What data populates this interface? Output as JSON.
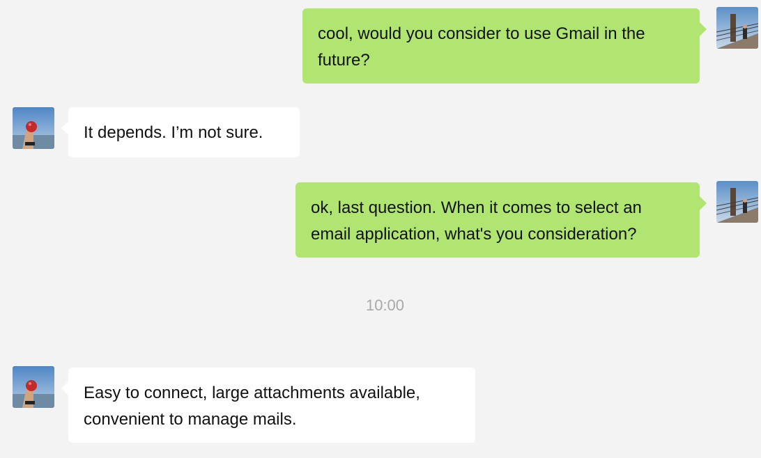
{
  "conversation": {
    "messages": [
      {
        "sender": "me",
        "text": "cool, would you consider to use Gmail in the future?"
      },
      {
        "sender": "contact",
        "text": "It depends. I’m not sure."
      },
      {
        "sender": "me",
        "text": "ok, last question. When it comes to select an email application, what's you consideration?"
      },
      {
        "sender": "contact",
        "text": "Easy to connect, large attachments available, convenient to manage mails."
      }
    ],
    "timestamp": "10:00"
  },
  "colors": {
    "background": "#f3f3f3",
    "outgoing_bubble": "#b1e572",
    "incoming_bubble": "#ffffff",
    "timestamp_text": "#a8a8a8"
  },
  "icons": {
    "my_avatar": "bridge-photo-avatar",
    "contact_avatar": "apple-hand-photo-avatar"
  }
}
